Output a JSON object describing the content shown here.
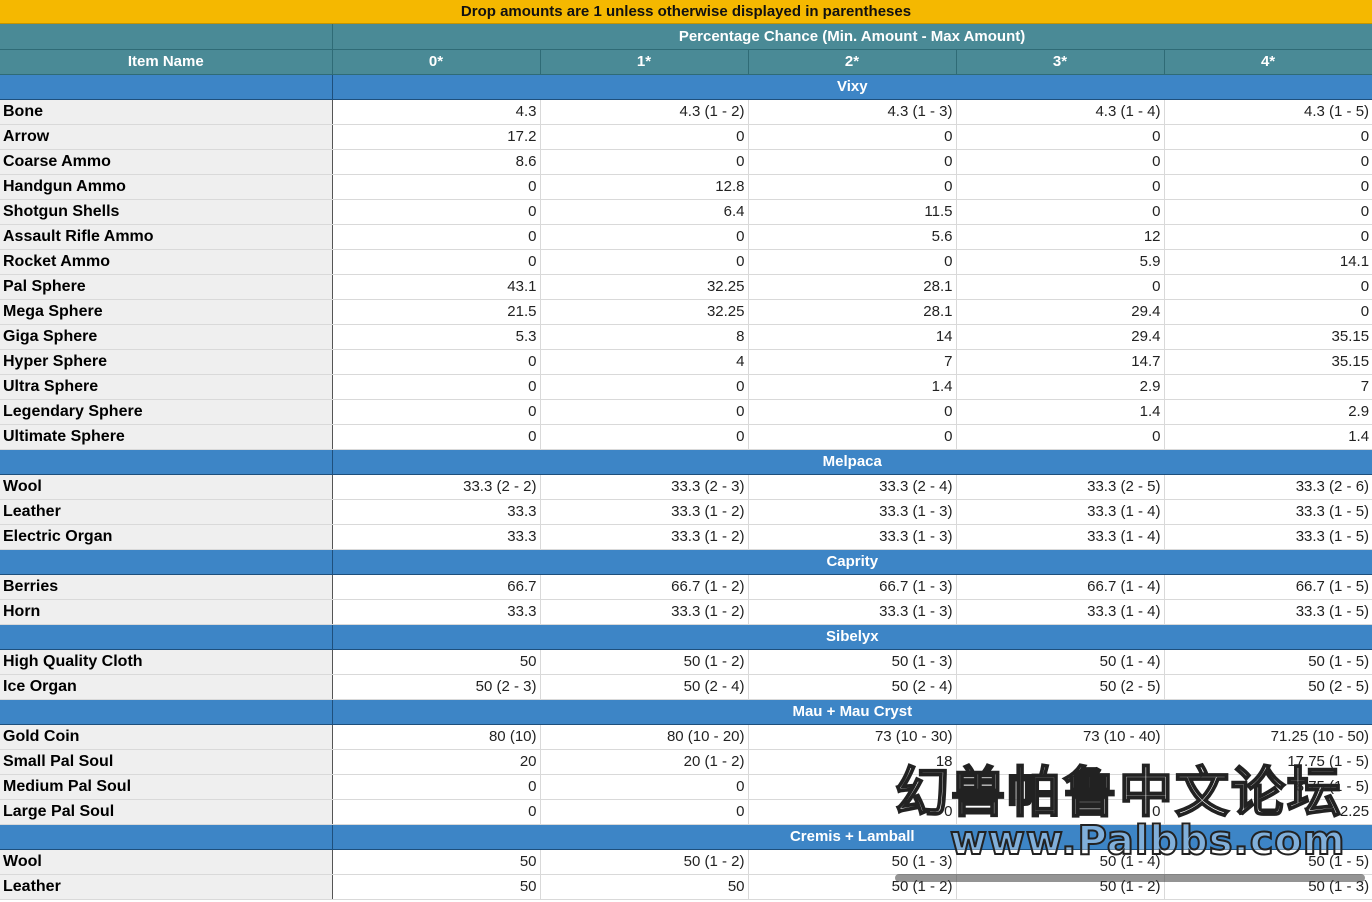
{
  "banner": "Drop amounts are 1 unless otherwise displayed in parentheses",
  "header": {
    "group_label": "Percentage Chance (Min. Amount - Max Amount)",
    "item_name": "Item Name",
    "columns": [
      "0*",
      "1*",
      "2*",
      "3*",
      "4*"
    ]
  },
  "sections": [
    {
      "title": "Vixy",
      "rows": [
        {
          "name": "Bone",
          "values": [
            "4.3",
            "4.3 (1 - 2)",
            "4.3 (1 - 3)",
            "4.3 (1 - 4)",
            "4.3 (1 - 5)"
          ]
        },
        {
          "name": "Arrow",
          "values": [
            "17.2",
            "0",
            "0",
            "0",
            "0"
          ]
        },
        {
          "name": "Coarse Ammo",
          "values": [
            "8.6",
            "0",
            "0",
            "0",
            "0"
          ]
        },
        {
          "name": "Handgun Ammo",
          "values": [
            "0",
            "12.8",
            "0",
            "0",
            "0"
          ]
        },
        {
          "name": "Shotgun Shells",
          "values": [
            "0",
            "6.4",
            "11.5",
            "0",
            "0"
          ]
        },
        {
          "name": "Assault Rifle Ammo",
          "values": [
            "0",
            "0",
            "5.6",
            "12",
            "0"
          ]
        },
        {
          "name": "Rocket Ammo",
          "values": [
            "0",
            "0",
            "0",
            "5.9",
            "14.1"
          ]
        },
        {
          "name": "Pal Sphere",
          "values": [
            "43.1",
            "32.25",
            "28.1",
            "0",
            "0"
          ]
        },
        {
          "name": "Mega Sphere",
          "values": [
            "21.5",
            "32.25",
            "28.1",
            "29.4",
            "0"
          ]
        },
        {
          "name": "Giga Sphere",
          "values": [
            "5.3",
            "8",
            "14",
            "29.4",
            "35.15"
          ]
        },
        {
          "name": "Hyper Sphere",
          "values": [
            "0",
            "4",
            "7",
            "14.7",
            "35.15"
          ]
        },
        {
          "name": "Ultra Sphere",
          "values": [
            "0",
            "0",
            "1.4",
            "2.9",
            "7"
          ]
        },
        {
          "name": "Legendary Sphere",
          "values": [
            "0",
            "0",
            "0",
            "1.4",
            "2.9"
          ]
        },
        {
          "name": "Ultimate Sphere",
          "values": [
            "0",
            "0",
            "0",
            "0",
            "1.4"
          ]
        }
      ]
    },
    {
      "title": "Melpaca",
      "rows": [
        {
          "name": "Wool",
          "values": [
            "33.3 (2 - 2)",
            "33.3 (2 - 3)",
            "33.3 (2 - 4)",
            "33.3 (2 - 5)",
            "33.3 (2 - 6)"
          ]
        },
        {
          "name": "Leather",
          "values": [
            "33.3",
            "33.3 (1 - 2)",
            "33.3 (1 - 3)",
            "33.3 (1 - 4)",
            "33.3 (1 - 5)"
          ]
        },
        {
          "name": "Electric Organ",
          "values": [
            "33.3",
            "33.3 (1 - 2)",
            "33.3  (1 - 3)",
            "33.3 (1 - 4)",
            "33.3 (1 - 5)"
          ]
        }
      ]
    },
    {
      "title": "Caprity",
      "rows": [
        {
          "name": "Berries",
          "values": [
            "66.7",
            "66.7 (1 - 2)",
            "66.7 (1 - 3)",
            "66.7 (1 - 4)",
            "66.7 (1 - 5)"
          ]
        },
        {
          "name": "Horn",
          "values": [
            "33.3",
            "33.3 (1 - 2)",
            "33.3 (1 - 3)",
            "33.3 (1 - 4)",
            "33.3 (1 - 5)"
          ]
        }
      ]
    },
    {
      "title": "Sibelyx",
      "rows": [
        {
          "name": "High Quality Cloth",
          "values": [
            "50",
            "50 (1 - 2)",
            "50 (1 - 3)",
            "50 (1 - 4)",
            "50 (1 - 5)"
          ]
        },
        {
          "name": "Ice Organ",
          "values": [
            "50 (2 - 3)",
            "50 (2 - 4)",
            "50 (2 - 4)",
            "50 (2 - 5)",
            "50 (2 - 5)"
          ]
        }
      ]
    },
    {
      "title": "Mau + Mau Cryst",
      "rows": [
        {
          "name": "Gold Coin",
          "values": [
            "80 (10)",
            "80 (10 - 20)",
            "73 (10 - 30)",
            "73 (10 - 40)",
            "71.25 (10 - 50)"
          ]
        },
        {
          "name": "Small Pal Soul",
          "values": [
            "20",
            "20 (1 - 2)",
            "18",
            "",
            "17.75 (1 - 5)"
          ]
        },
        {
          "name": "Medium Pal Soul",
          "values": [
            "0",
            "0",
            "",
            "",
            "8.75 (1 - 5)"
          ]
        },
        {
          "name": "Large Pal Soul",
          "values": [
            "0",
            "0",
            "0",
            "0",
            "2.25"
          ]
        }
      ]
    },
    {
      "title": "Cremis + Lamball",
      "rows": [
        {
          "name": "Wool",
          "values": [
            "50",
            "50 (1 - 2)",
            "50 (1 - 3)",
            "50 (1 - 4)",
            "50 (1 - 5)"
          ]
        },
        {
          "name": "Leather",
          "values": [
            "50",
            "50",
            "50 (1 - 2)",
            "50 (1 - 2)",
            "50 (1 - 3)"
          ]
        }
      ]
    }
  ],
  "watermark": {
    "title": "幻兽帕鲁中文论坛",
    "url": "www.Palbbs.com"
  }
}
